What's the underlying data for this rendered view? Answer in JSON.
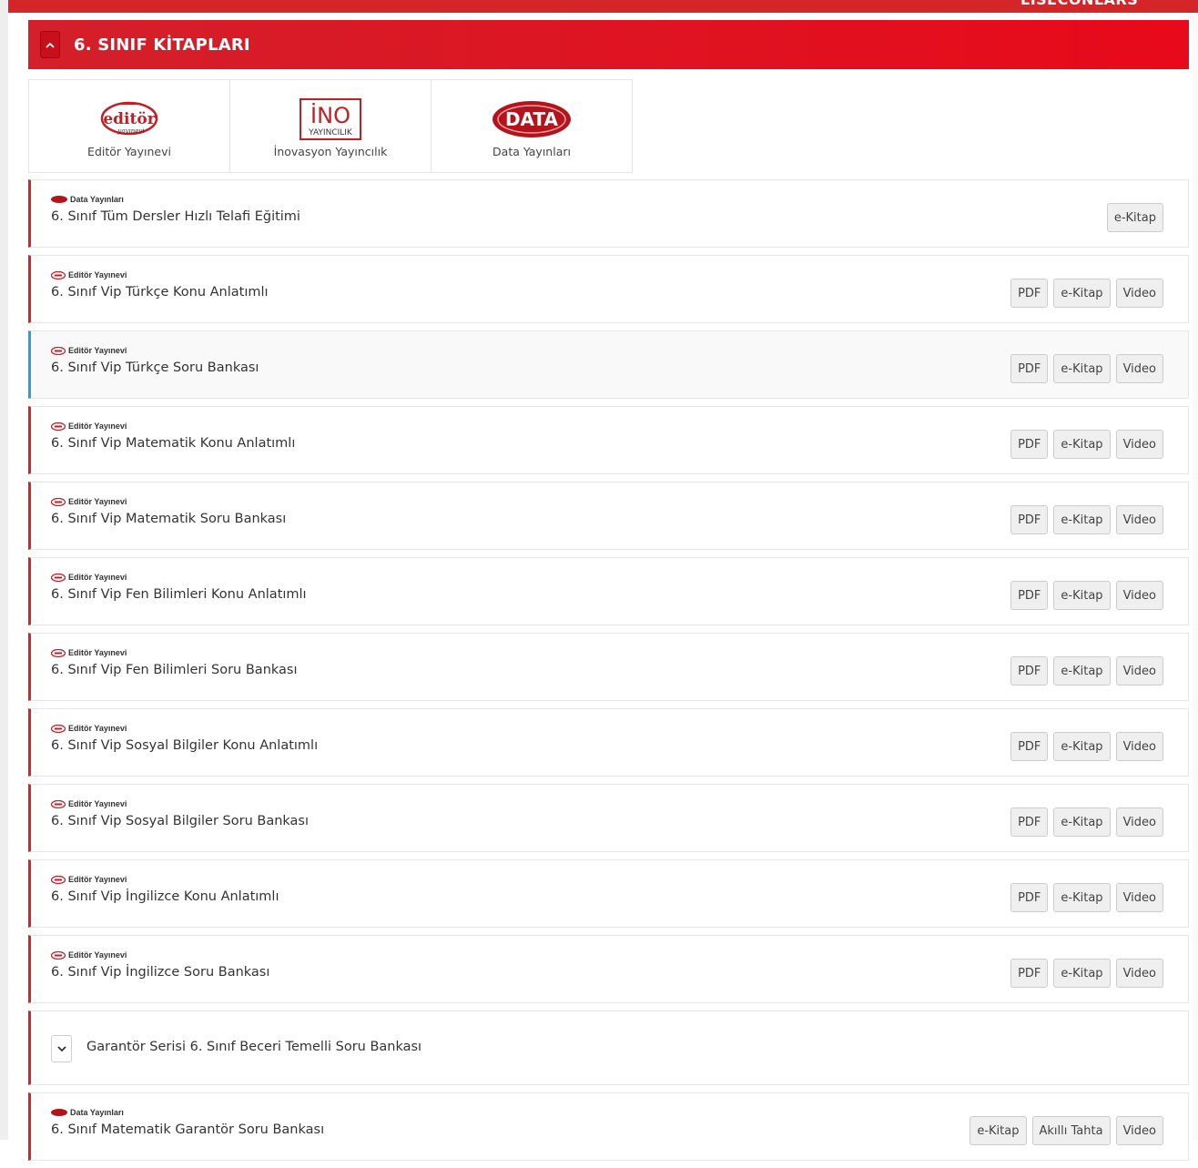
{
  "top_bar": {
    "cut_text": "LISECONLARS"
  },
  "section": {
    "title": "6. SINIF KİTAPLARI"
  },
  "publishers": [
    {
      "name": "Editör Yayınevi",
      "logo": "editor-logo"
    },
    {
      "name": "İnovasyon Yayıncılık",
      "logo": "ino-logo",
      "logo_text_top": "İNO",
      "logo_text_bottom": "YAYINCILIK"
    },
    {
      "name": "Data Yayınları",
      "logo": "data-logo",
      "logo_text": "DATA"
    }
  ],
  "books": [
    {
      "publisher": "Data Yayınları",
      "pub_logo": "data",
      "title": "6. Sınıf Tüm Dersler Hızlı Telafi Eğitimi",
      "buttons": [
        "e-Kitap"
      ]
    },
    {
      "publisher": "Editör Yayınevi",
      "pub_logo": "editor",
      "title": "6. Sınıf Vip Türkçe Konu Anlatımlı",
      "buttons": [
        "PDF",
        "e-Kitap",
        "Video"
      ]
    },
    {
      "publisher": "Editör Yayınevi",
      "pub_logo": "editor",
      "title": "6. Sınıf Vip Türkçe Soru Bankası",
      "buttons": [
        "PDF",
        "e-Kitap",
        "Video"
      ],
      "active": true
    },
    {
      "publisher": "Editör Yayınevi",
      "pub_logo": "editor",
      "title": "6. Sınıf Vip Matematik Konu Anlatımlı",
      "buttons": [
        "PDF",
        "e-Kitap",
        "Video"
      ]
    },
    {
      "publisher": "Editör Yayınevi",
      "pub_logo": "editor",
      "title": "6. Sınıf Vip Matematik Soru Bankası",
      "buttons": [
        "PDF",
        "e-Kitap",
        "Video"
      ]
    },
    {
      "publisher": "Editör Yayınevi",
      "pub_logo": "editor",
      "title": "6. Sınıf Vip Fen Bilimleri Konu Anlatımlı",
      "buttons": [
        "PDF",
        "e-Kitap",
        "Video"
      ]
    },
    {
      "publisher": "Editör Yayınevi",
      "pub_logo": "editor",
      "title": "6. Sınıf Vip Fen Bilimleri Soru Bankası",
      "buttons": [
        "PDF",
        "e-Kitap",
        "Video"
      ]
    },
    {
      "publisher": "Editör Yayınevi",
      "pub_logo": "editor",
      "title": "6. Sınıf Vip Sosyal Bilgiler Konu Anlatımlı",
      "buttons": [
        "PDF",
        "e-Kitap",
        "Video"
      ]
    },
    {
      "publisher": "Editör Yayınevi",
      "pub_logo": "editor",
      "title": "6. Sınıf Vip Sosyal Bilgiler Soru Bankası",
      "buttons": [
        "PDF",
        "e-Kitap",
        "Video"
      ]
    },
    {
      "publisher": "Editör Yayınevi",
      "pub_logo": "editor",
      "title": "6. Sınıf Vip İngilizce Konu Anlatımlı",
      "buttons": [
        "PDF",
        "e-Kitap",
        "Video"
      ]
    },
    {
      "publisher": "Editör Yayınevi",
      "pub_logo": "editor",
      "title": "6. Sınıf Vip İngilizce Soru Bankası",
      "buttons": [
        "PDF",
        "e-Kitap",
        "Video"
      ]
    }
  ],
  "group": {
    "title": "Garantör Serisi 6. Sınıf Beceri Temelli Soru Bankası"
  },
  "last_book": {
    "publisher": "Data Yayınları",
    "pub_logo": "data",
    "title": "6. Sınıf Matematik Garantör Soru Bankası",
    "buttons": [
      "e-Kitap",
      "Akıllı Tahta",
      "Video"
    ]
  },
  "colors": {
    "accent_red": "#d62528",
    "active_blue": "#27a0e0"
  }
}
